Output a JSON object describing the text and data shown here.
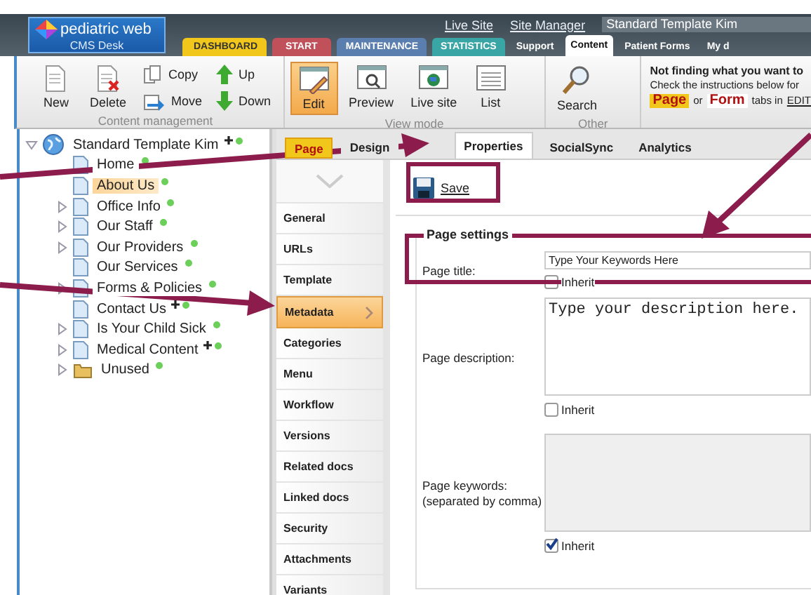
{
  "logo": {
    "name": "pediatric web",
    "subtitle": "CMS Desk"
  },
  "top_links": [
    "Live Site",
    "Site Manager"
  ],
  "site_field": {
    "value": "Standard Template Kim"
  },
  "main_tabs": [
    {
      "label": "DASHBOARD",
      "kind": "dashboard",
      "selected": false
    },
    {
      "label": "START",
      "kind": "start",
      "selected": false
    },
    {
      "label": "MAINTENANCE",
      "kind": "maintenance",
      "selected": false
    },
    {
      "label": "STATISTICS",
      "kind": "statistics",
      "selected": false
    },
    {
      "label": "Support",
      "kind": "plain",
      "selected": false
    },
    {
      "label": "Content",
      "kind": "plain",
      "selected": true
    },
    {
      "label": "Patient Forms",
      "kind": "plain",
      "selected": false
    },
    {
      "label": "My d",
      "kind": "plain",
      "selected": false
    }
  ],
  "toolbar_groups": [
    {
      "label": "Content management",
      "buttons": [
        {
          "label": "New",
          "kind": "new",
          "selected": false
        },
        {
          "label": "Delete",
          "kind": "delete",
          "selected": false
        },
        {
          "label": "Copy",
          "kind": "copy",
          "selected": false
        },
        {
          "label": "Move",
          "kind": "move",
          "selected": false
        },
        {
          "label": "Up",
          "kind": "up",
          "selected": false
        },
        {
          "label": "Down",
          "kind": "down",
          "selected": false
        }
      ]
    },
    {
      "label": "View mode",
      "buttons": [
        {
          "label": "Edit",
          "kind": "edit",
          "selected": true
        },
        {
          "label": "Preview",
          "kind": "preview",
          "selected": false
        },
        {
          "label": "Live site",
          "kind": "livesite",
          "selected": false
        },
        {
          "label": "List",
          "kind": "list",
          "selected": false
        }
      ]
    },
    {
      "label": "Other",
      "buttons": [
        {
          "label": "Search",
          "kind": "search",
          "selected": false
        }
      ]
    }
  ],
  "help_note": {
    "heading": "Not finding what you want to",
    "line": "Check the instructions below for",
    "page_badge": "Page",
    "joiner": "or",
    "form_badge": "Form",
    "tail": "tabs in",
    "link": "EDIT"
  },
  "tree": {
    "label": "Standard Template Kim",
    "kind": "site",
    "expandable": true,
    "expanded": true,
    "flagged": true,
    "published": true,
    "selected": false,
    "children": [
      {
        "label": "Home",
        "kind": "page",
        "expandable": false,
        "flagged": false,
        "published": true,
        "selected": false
      },
      {
        "label": "About Us",
        "kind": "page",
        "expandable": false,
        "flagged": false,
        "published": true,
        "selected": true
      },
      {
        "label": "Office Info",
        "kind": "page",
        "expandable": true,
        "flagged": false,
        "published": true,
        "selected": false
      },
      {
        "label": "Our Staff",
        "kind": "page",
        "expandable": true,
        "flagged": false,
        "published": true,
        "selected": false
      },
      {
        "label": "Our Providers",
        "kind": "page",
        "expandable": true,
        "flagged": false,
        "published": true,
        "selected": false
      },
      {
        "label": "Our Services",
        "kind": "page",
        "expandable": false,
        "flagged": false,
        "published": true,
        "selected": false
      },
      {
        "label": "Forms & Policies",
        "kind": "page",
        "expandable": true,
        "flagged": false,
        "published": true,
        "selected": false
      },
      {
        "label": "Contact Us",
        "kind": "page",
        "expandable": false,
        "flagged": true,
        "published": true,
        "selected": false
      },
      {
        "label": "Is Your Child Sick",
        "kind": "page",
        "expandable": true,
        "flagged": false,
        "published": true,
        "selected": false
      },
      {
        "label": "Medical Content",
        "kind": "page",
        "expandable": true,
        "flagged": true,
        "published": true,
        "selected": false
      },
      {
        "label": "Unused",
        "kind": "folder",
        "expandable": true,
        "flagged": false,
        "published": true,
        "selected": false
      }
    ]
  },
  "mode_tabs": [
    {
      "label": "Page",
      "kind": "highlight",
      "selected": false
    },
    {
      "label": "Design",
      "kind": "plain",
      "selected": false
    },
    {
      "label": "Properties",
      "kind": "plain",
      "selected": true
    },
    {
      "label": "SocialSync",
      "kind": "plain",
      "selected": false
    },
    {
      "label": "Analytics",
      "kind": "plain",
      "selected": false
    }
  ],
  "property_nav": [
    {
      "label": "General",
      "selected": false
    },
    {
      "label": "URLs",
      "selected": false
    },
    {
      "label": "Template",
      "selected": false
    },
    {
      "label": "Metadata",
      "selected": true
    },
    {
      "label": "Categories",
      "selected": false
    },
    {
      "label": "Menu",
      "selected": false
    },
    {
      "label": "Workflow",
      "selected": false
    },
    {
      "label": "Versions",
      "selected": false
    },
    {
      "label": "Related docs",
      "selected": false
    },
    {
      "label": "Linked docs",
      "selected": false
    },
    {
      "label": "Security",
      "selected": false
    },
    {
      "label": "Attachments",
      "selected": false
    },
    {
      "label": "Variants",
      "selected": false
    }
  ],
  "save_button": "Save",
  "settings": {
    "legend": "Page settings",
    "fields": [
      {
        "kind": "input",
        "label": "Page title:",
        "value": "Type Your Keywords Here",
        "disabled": false,
        "inherit": {
          "label": "Inherit",
          "checked": false
        }
      },
      {
        "kind": "textarea",
        "label": "Page description:",
        "value": "Type your description here.",
        "disabled": false,
        "inherit": {
          "label": "Inherit",
          "checked": false
        }
      },
      {
        "kind": "textarea",
        "label": "Page keywords:\n(separated by comma)",
        "disabled": true,
        "inherit": {
          "label": "Inherit",
          "checked": true
        }
      }
    ]
  }
}
